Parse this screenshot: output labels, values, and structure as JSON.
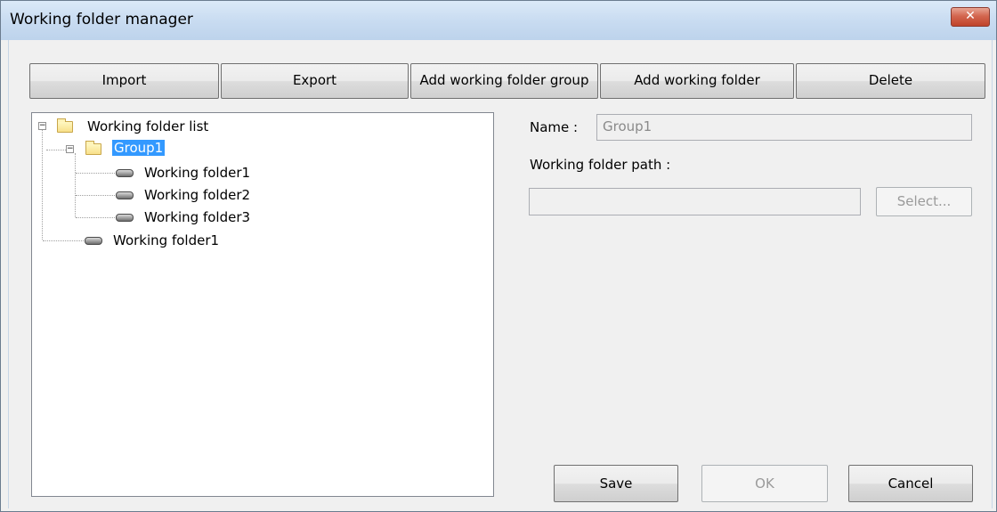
{
  "window": {
    "title": "Working folder manager",
    "close_glyph": "✕"
  },
  "toolbar": {
    "import": "Import",
    "export": "Export",
    "add_group": "Add working folder group",
    "add_folder": "Add working folder",
    "delete": "Delete"
  },
  "tree": {
    "root": {
      "label": "Working folder list",
      "expander": "−",
      "icon": "folder-icon"
    },
    "group": {
      "label": "Group1",
      "expander": "−",
      "icon": "folder-icon",
      "selected": true
    },
    "group_children": [
      "Working folder1",
      "Working folder2",
      "Working folder3"
    ],
    "root_child": "Working folder1"
  },
  "details": {
    "name_label": "Name :",
    "name_value": "Group1",
    "path_label": "Working folder path :",
    "path_value": "",
    "select_button": "Select..."
  },
  "footer": {
    "save": "Save",
    "ok": "OK",
    "cancel": "Cancel"
  },
  "colors": {
    "selection": "#3399ff",
    "dialog_bg": "#f0f0f0",
    "close_button": "#c0432a"
  }
}
